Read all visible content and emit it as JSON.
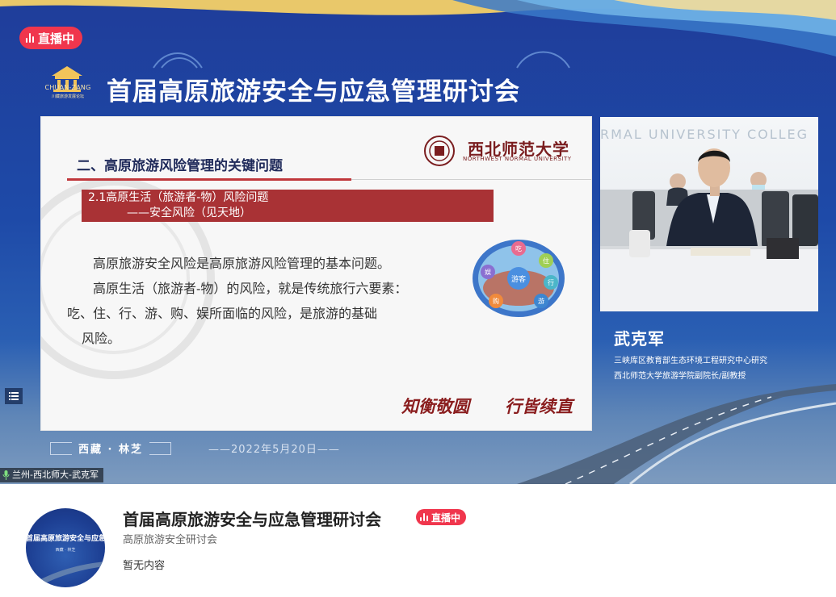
{
  "live_badge": {
    "label": "直播中"
  },
  "logo": {
    "text": "CHUAN-ZANG",
    "subtitle": "川藏旅游发展论坛"
  },
  "conference_title": "首届高原旅游安全与应急管理研讨会",
  "slide": {
    "heading": "二、高原旅游风险管理的关键问题",
    "university_name": "西北师范大学",
    "university_en": "NORTHWEST NORMAL UNIVERSITY",
    "subheading_1": "2.1高原生活（旅游者-物）风险问题",
    "subheading_2": "——安全风险（见天地）",
    "paragraph_lines": [
      "高原旅游安全风险是高原旅游风险管理的基本问题。",
      "高原生活（旅游者-物）的风险，就是传统旅行六要素：",
      "吃、住、行、游、购、娱所面临的风险，是旅游的基础",
      "风险。"
    ],
    "diagram": {
      "center": "游客",
      "nodes": [
        "吃",
        "住",
        "行",
        "游",
        "购",
        "娱"
      ]
    },
    "motto_1": "知衡敬圆",
    "motto_2": "行皆续直"
  },
  "camera": {
    "banner": "RMAL UNIVERSITY COLLEG"
  },
  "speaker": {
    "name": "武克军",
    "title_1": "三峡库区教育部生态环境工程研究中心研究",
    "title_2": "西北师范大学旅游学院副院长/副教授"
  },
  "footer": {
    "location": "西藏 · 林芝",
    "date": "——2022年5月20日——"
  },
  "mic_label": "兰州-西北师大-武克军",
  "info": {
    "title": "首届高原旅游安全与应急管理研讨会",
    "live_label": "直播中",
    "subtitle": "高原旅游安全研讨会",
    "empty_text": "暂无内容",
    "avatar_title": "首届高原旅游安全与应急管理",
    "avatar_sub": "西藏 · 林芝"
  },
  "colors": {
    "live_red": "#f0364d",
    "slide_red": "#a93235",
    "brand_blue": "#1f3d9a"
  }
}
